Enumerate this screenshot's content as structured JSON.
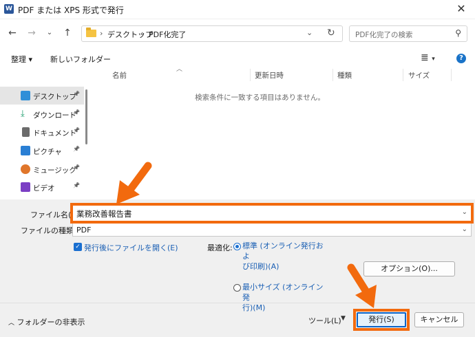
{
  "window": {
    "title": "PDF または XPS 形式で発行",
    "app_icon": "W"
  },
  "address": {
    "crumbs": [
      "デスクトップ",
      "PDF化完了"
    ],
    "separator": "›"
  },
  "search": {
    "placeholder": "PDF化完了の検索"
  },
  "toolbar": {
    "organize_label": "整理 ▾",
    "new_folder_label": "新しいフォルダー"
  },
  "nav": {
    "items": [
      {
        "label": "デスクトップ",
        "icon": "desktop-icon",
        "color": "#2f8fd8"
      },
      {
        "label": "ダウンロード",
        "icon": "download-icon",
        "color": "#1a9b6a"
      },
      {
        "label": "ドキュメント",
        "icon": "document-icon",
        "color": "#6b6b6b"
      },
      {
        "label": "ピクチャ",
        "icon": "pictures-icon",
        "color": "#2a7fd4"
      },
      {
        "label": "ミュージック",
        "icon": "music-icon",
        "color": "#e0762b"
      },
      {
        "label": "ビデオ",
        "icon": "video-icon",
        "color": "#7b3fc4"
      }
    ]
  },
  "filelist": {
    "columns": [
      "名前",
      "更新日時",
      "種類",
      "サイズ"
    ],
    "empty_message": "検索条件に一致する項目はありません。"
  },
  "form": {
    "filename_label": "ファイル名(N):",
    "filename_value": "業務改善報告書",
    "filetype_label": "ファイルの種類(T):",
    "filetype_value": "PDF",
    "open_after_label": "発行後にファイルを開く(E)",
    "optimize_label": "最適化:",
    "radio_standard_1": "標準 (オンライン発行およ",
    "radio_standard_2": "び印刷)(A)",
    "radio_min_1": "最小サイズ (オンライン発",
    "radio_min_2": "行)(M)",
    "options_label": "オプション(O)..."
  },
  "footer": {
    "hide_folders_label": "フォルダーの非表示",
    "tools_label": "ツール(L)",
    "publish_label": "発行(S)",
    "cancel_label": "キャンセル"
  },
  "colors": {
    "annotation": "#f26a0e",
    "accent": "#1a6fd0"
  }
}
